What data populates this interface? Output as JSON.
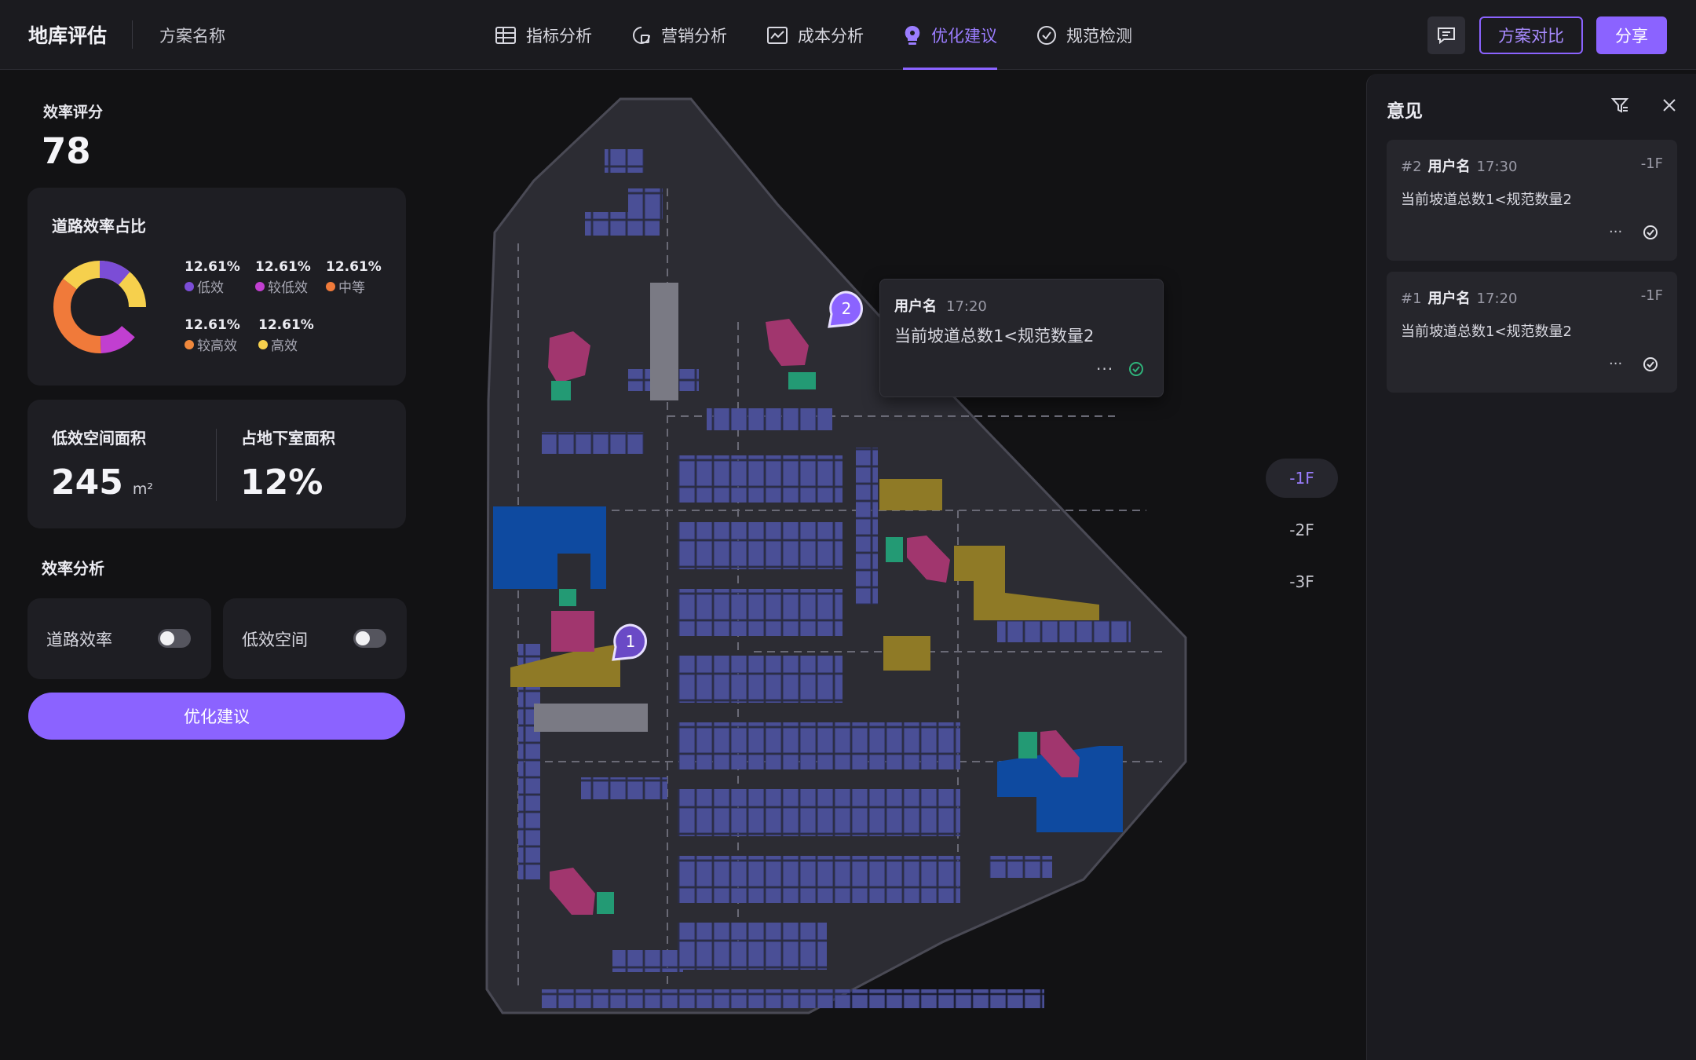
{
  "header": {
    "app_title": "地库评估",
    "plan_name": "方案名称",
    "tabs": [
      {
        "label": "指标分析",
        "icon": "table-icon"
      },
      {
        "label": "营销分析",
        "icon": "marketing-icon"
      },
      {
        "label": "成本分析",
        "icon": "cost-icon"
      },
      {
        "label": "优化建议",
        "icon": "lightbulb-icon",
        "active": true
      },
      {
        "label": "规范检测",
        "icon": "check-circle-icon"
      }
    ],
    "compare_label": "方案对比",
    "share_label": "分享",
    "accent": "#8b63ff"
  },
  "left": {
    "score_title": "效率评分",
    "score_value": "78",
    "road_card": {
      "title": "道路效率占比",
      "segments": [
        {
          "pct": "12.61%",
          "label": "低效",
          "color": "#7b4dd6"
        },
        {
          "pct": "12.61%",
          "label": "较低效",
          "color": "#c13fd0"
        },
        {
          "pct": "12.61%",
          "label": "中等",
          "color": "#f07a3a"
        },
        {
          "pct": "12.61%",
          "label": "较高效",
          "color": "#f0883c"
        },
        {
          "pct": "12.61%",
          "label": "高效",
          "color": "#f6d04d"
        }
      ]
    },
    "area_card": {
      "low_label": "低效空间面积",
      "low_value": "245",
      "low_unit": "m²",
      "ratio_label": "占地下室面积",
      "ratio_value": "12%"
    },
    "analysis_title": "效率分析",
    "toggles": [
      {
        "label": "道路效率",
        "on": false
      },
      {
        "label": "低效空间",
        "on": false
      }
    ],
    "optimize_button": "优化建议"
  },
  "map": {
    "pins": [
      "1",
      "2"
    ],
    "popover": {
      "user": "用户名",
      "time": "17:20",
      "text": "当前坡道总数1<规范数量2",
      "more": "···"
    }
  },
  "floors": [
    "-1F",
    "-2F",
    "-3F"
  ],
  "panel": {
    "title": "意见",
    "comments": [
      {
        "id": "#2",
        "user": "用户名",
        "time": "17:30",
        "floor": "-1F",
        "text": "当前坡道总数1<规范数量2",
        "more": "···"
      },
      {
        "id": "#1",
        "user": "用户名",
        "time": "17:20",
        "floor": "-1F",
        "text": "当前坡道总数1<规范数量2",
        "more": "···"
      }
    ]
  }
}
